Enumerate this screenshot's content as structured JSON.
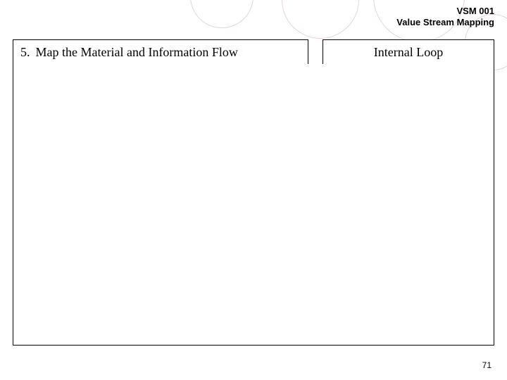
{
  "header": {
    "code": "VSM 001",
    "title": "Value Stream Mapping"
  },
  "left_box": {
    "number": "5.",
    "label": "Map the Material and Information Flow"
  },
  "right_box": {
    "label": "Internal Loop"
  },
  "page_number": "71"
}
